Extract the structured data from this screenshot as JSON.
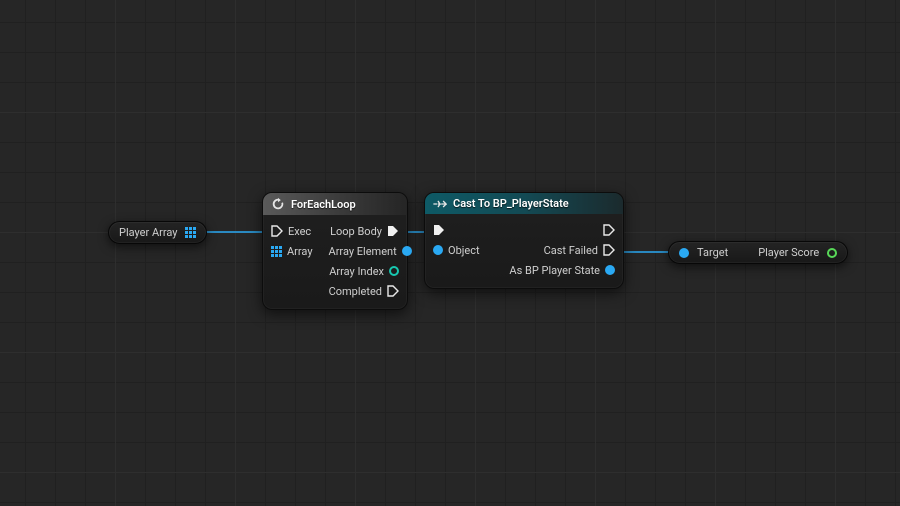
{
  "playerArrayPill": {
    "label": "Player Array"
  },
  "forEachLoop": {
    "title": "ForEachLoop",
    "inputs": {
      "exec": "Exec",
      "array": "Array"
    },
    "outputs": {
      "loopBody": "Loop Body",
      "arrayElement": "Array Element",
      "arrayIndex": "Array Index",
      "completed": "Completed"
    }
  },
  "castNode": {
    "title": "Cast To BP_PlayerState",
    "inputs": {
      "exec": "",
      "object": "Object"
    },
    "outputs": {
      "exec": "",
      "castFailed": "Cast Failed",
      "asPlayerState": "As BP Player State"
    }
  },
  "getterPill": {
    "target": "Target",
    "output": "Player Score"
  }
}
